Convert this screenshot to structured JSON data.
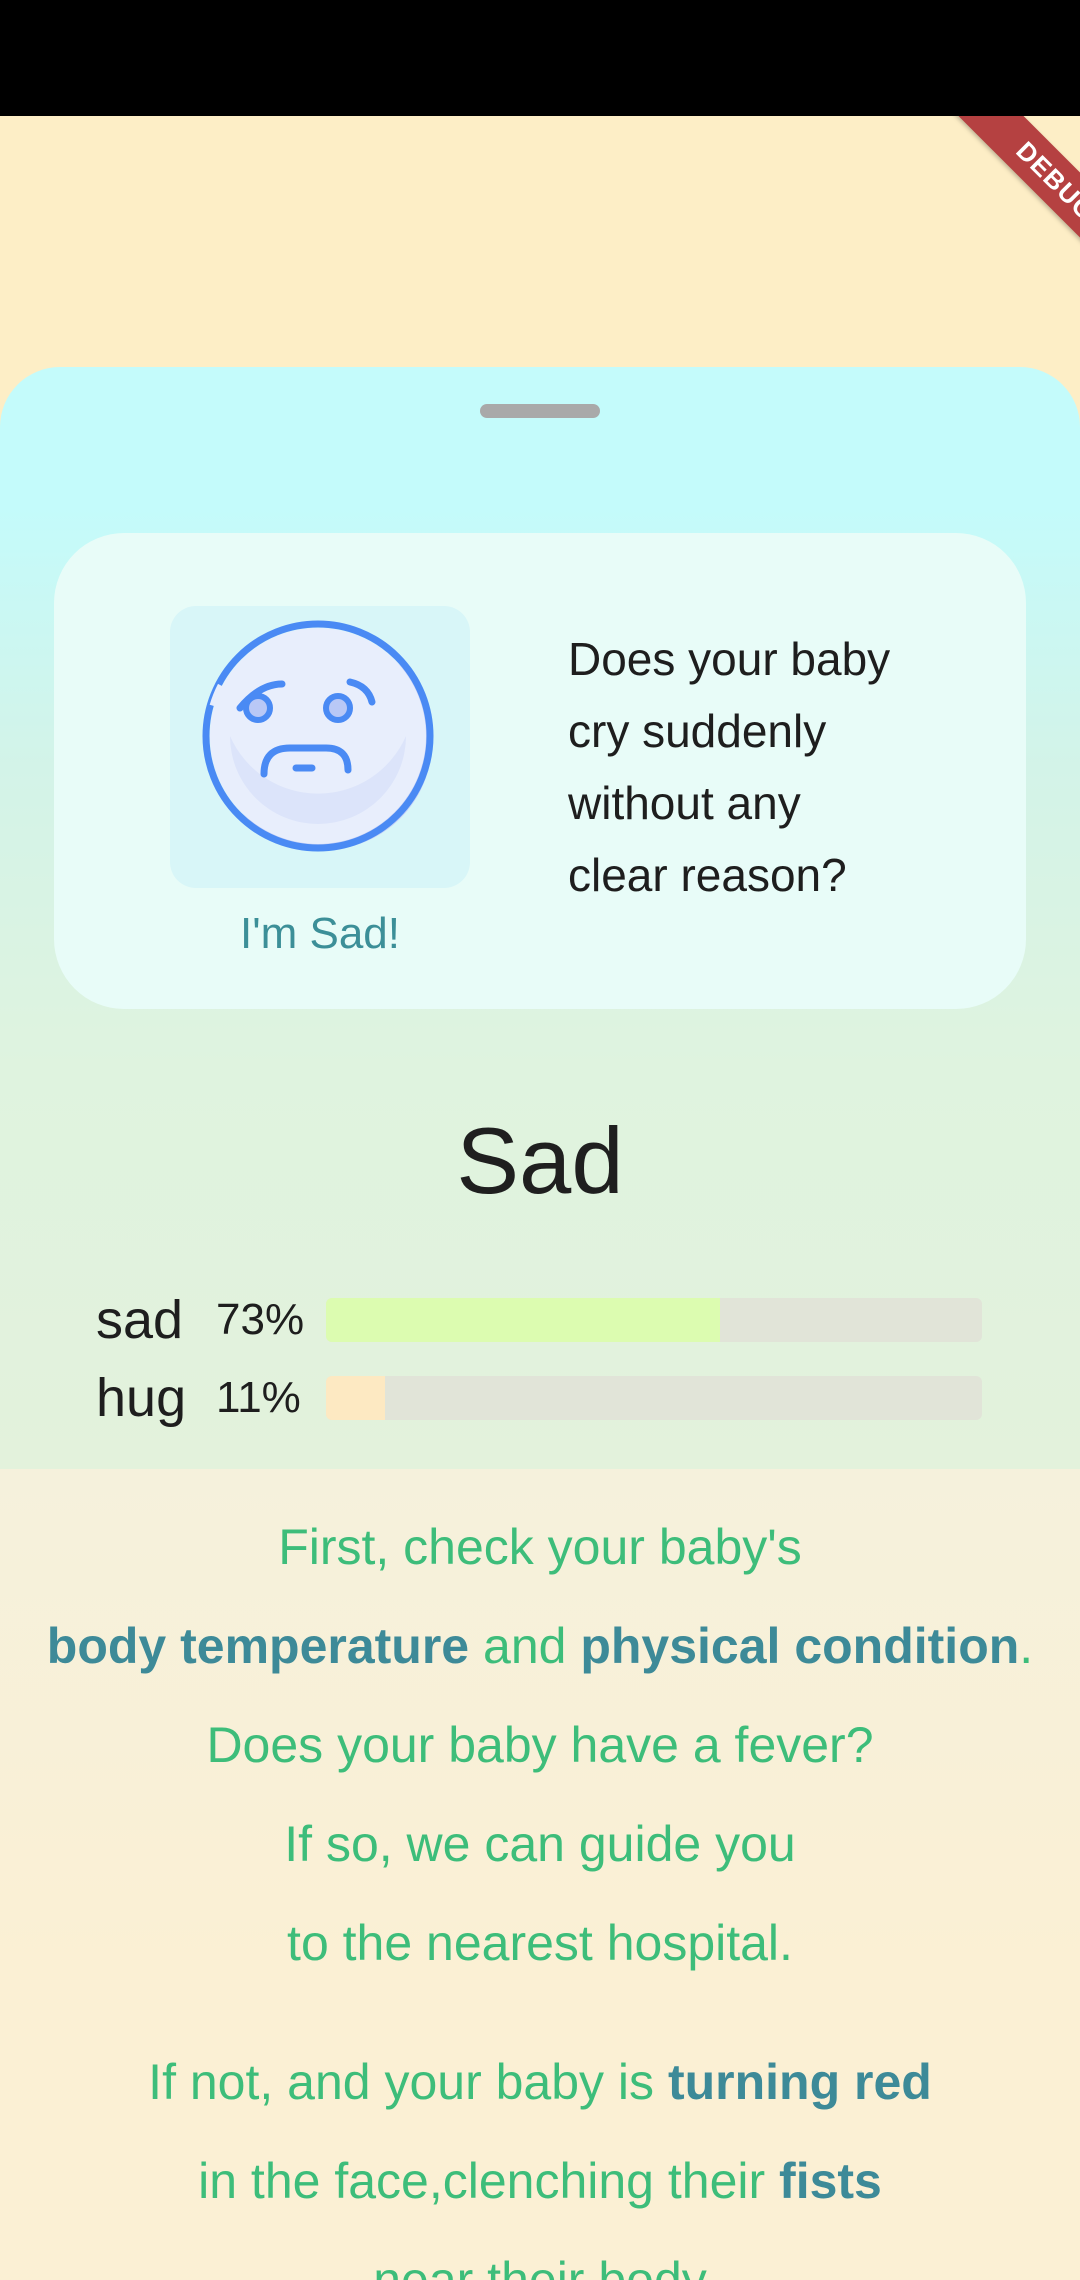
{
  "debug_banner": {
    "label": "DEBUG"
  },
  "card": {
    "emoji_caption": "I'm Sad!",
    "question_lines": [
      "Does your baby",
      "cry suddenly",
      "without any",
      "clear reason?"
    ]
  },
  "mood": {
    "title": "Sad"
  },
  "bars": [
    {
      "label": "sad",
      "percent_label": "73%",
      "fill_fraction": 0.6,
      "color": "#dcfcb0"
    },
    {
      "label": "hug",
      "percent_label": "11%",
      "fill_fraction": 0.09,
      "color": "#fde9c2"
    }
  ],
  "advice": {
    "line1": "First, check your baby's",
    "line2_bold_a": "body temperature",
    "line2_mid": " and ",
    "line2_bold_b": "physical condition",
    "line2_end": ".",
    "line3": "Does your baby have a fever?",
    "line4": "If so, we can guide you",
    "line5": "to the nearest hospital.",
    "line6_pre": "If not, and your baby is ",
    "line6_bold": "turning red",
    "line7_pre": "in the face,clenching their ",
    "line7_bold": "fists",
    "line8": "near their body"
  },
  "colors": {
    "accent_text": "#3dbd7a",
    "emphasis_text": "#3d8a98",
    "emoji_stroke": "#4a8af4"
  }
}
